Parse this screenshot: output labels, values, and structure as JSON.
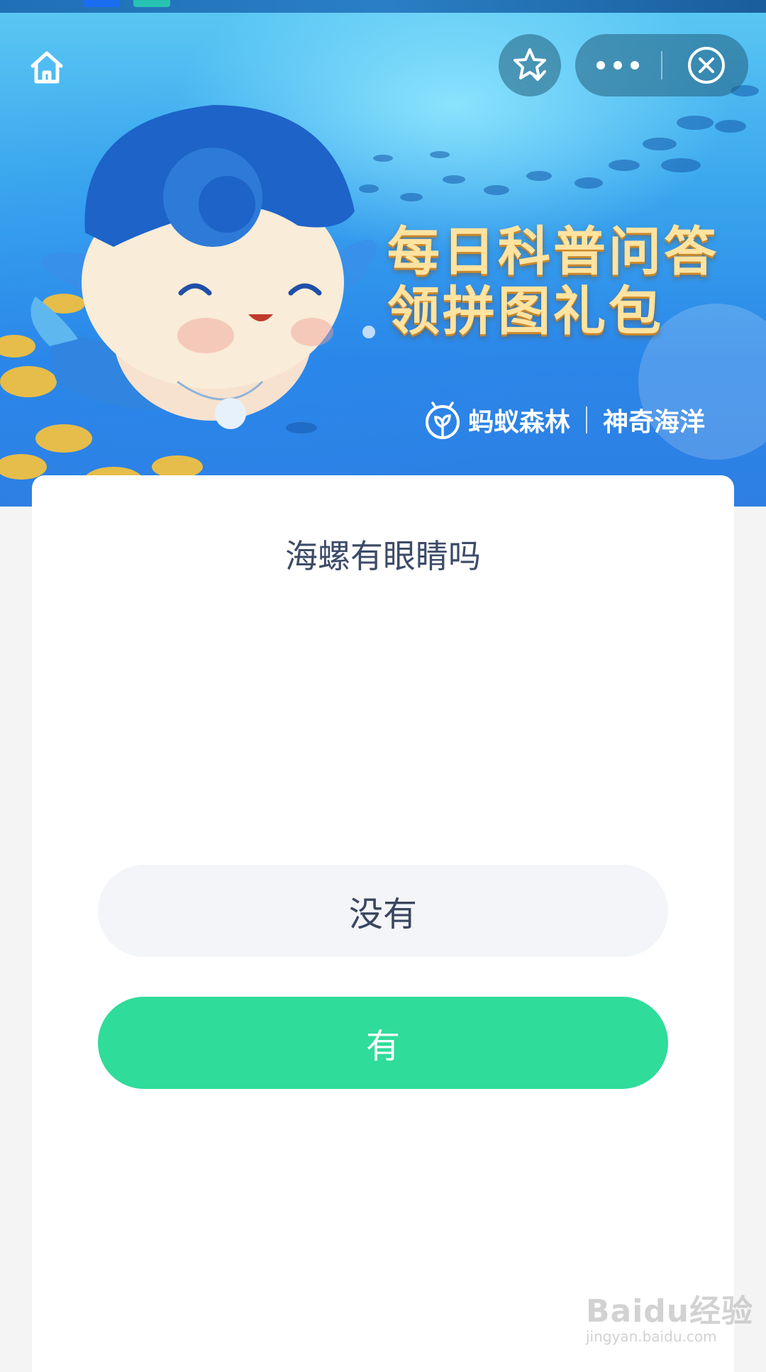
{
  "banner": {
    "headline_line1": "每日科普问答",
    "headline_line2": "领拼图礼包",
    "brand_primary": "蚂蚁森林",
    "brand_secondary": "神奇海洋"
  },
  "topbar": {
    "icons": [
      "home-icon",
      "star-check-icon",
      "more-icon",
      "close-icon"
    ]
  },
  "quiz": {
    "question": "海螺有眼睛吗",
    "options": [
      {
        "label": "没有"
      },
      {
        "label": "有"
      }
    ]
  },
  "watermark": {
    "line1": "Baidu经验",
    "line2": "jingyan.baidu.com"
  },
  "colors": {
    "answer_selected": "#2fdc9a",
    "answer_default": "#f3f5f8",
    "question_text": "#3d4b68",
    "headline_gold": "#ffe3a0"
  }
}
